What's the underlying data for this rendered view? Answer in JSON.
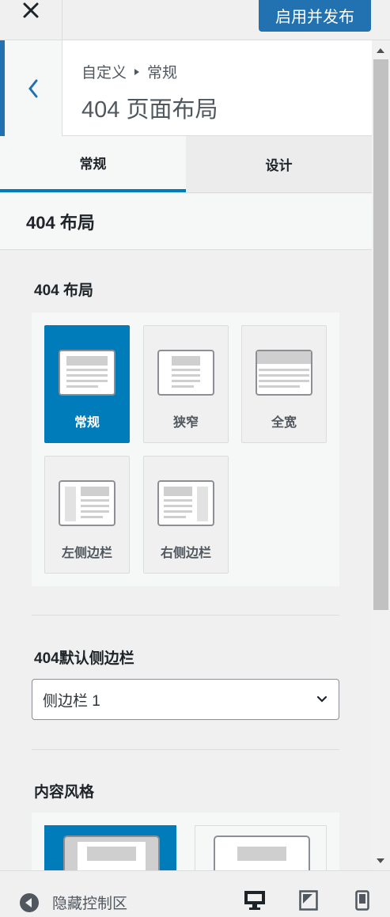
{
  "header": {
    "close_icon": "close-icon",
    "publish_label": "启用并发布"
  },
  "section": {
    "back_icon": "chevron-left-icon",
    "breadcrumb_root": "自定义",
    "breadcrumb_current": "常规",
    "title": "404 页面布局"
  },
  "tabs": [
    {
      "label": "常规",
      "active": true
    },
    {
      "label": "设计",
      "active": false
    }
  ],
  "group_heading": "404 布局",
  "layout_control": {
    "label": "404 布局",
    "options": [
      {
        "label": "常规",
        "selected": true
      },
      {
        "label": "狭窄",
        "selected": false
      },
      {
        "label": "全宽",
        "selected": false
      },
      {
        "label": "左侧边栏",
        "selected": false
      },
      {
        "label": "右侧边栏",
        "selected": false
      }
    ]
  },
  "sidebar_control": {
    "label": "404默认侧边栏",
    "value": "侧边栏 1"
  },
  "content_style_control": {
    "label": "内容风格"
  },
  "footer": {
    "collapse_label": "隐藏控制区",
    "devices": [
      "desktop-icon",
      "tablet-icon",
      "mobile-icon"
    ]
  },
  "colors": {
    "accent": "#007cba",
    "primary_button": "#2271b1"
  }
}
